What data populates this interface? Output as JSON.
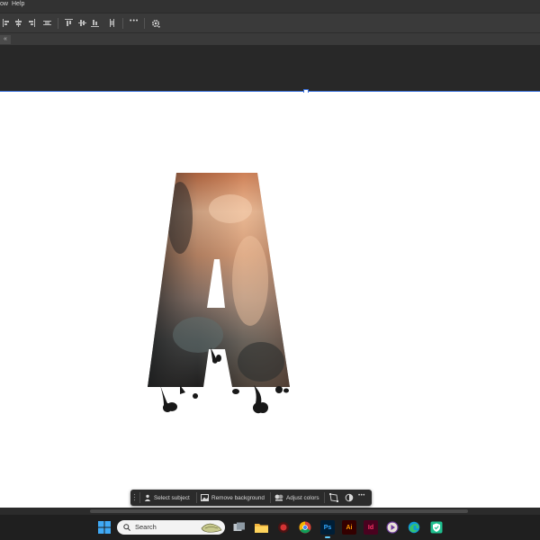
{
  "menu": {
    "items": [
      "ow",
      "Help"
    ]
  },
  "tab_strip": {
    "close_glyph": "«"
  },
  "context_bar": {
    "select_subject": "Select subject",
    "remove_background": "Remove background",
    "adjust_colors": "Adjust colors",
    "more_glyph": "•••"
  },
  "options_bar": {
    "more_glyph": "•••"
  },
  "windows_taskbar": {
    "search_label": "Search",
    "apps": [
      {
        "name": "File Explorer",
        "color": "#f3b53f"
      },
      {
        "name": "Chrome",
        "color": "#db4437"
      },
      {
        "name": "Photoshop",
        "label": "Ps",
        "color": "#31a8ff"
      },
      {
        "name": "Illustrator",
        "label": "Ai",
        "color": "#ff9a00"
      },
      {
        "name": "InDesign",
        "label": "Id",
        "color": "#ff3366"
      },
      {
        "name": "Edge",
        "color": "#0f9bd7"
      }
    ]
  },
  "colors": {
    "selection_blue": "#3a6fd8",
    "taskbar_active": "#60cdff"
  },
  "artwork": {
    "subject": "Letter A with drip effect"
  }
}
